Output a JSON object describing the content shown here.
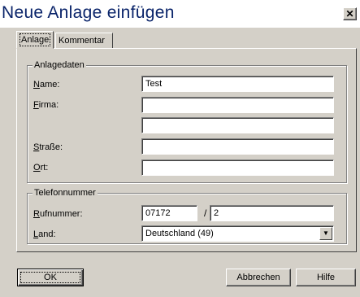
{
  "window": {
    "title": "Neue Anlage einfügen",
    "close_glyph": "✕"
  },
  "tabs": [
    {
      "label": "Anlage",
      "active": true
    },
    {
      "label": "Kommentar",
      "active": false
    }
  ],
  "anlagedaten": {
    "legend": "Anlagedaten",
    "name": {
      "label_ul": "N",
      "label_rest": "ame:",
      "value": "Test"
    },
    "firma": {
      "label_ul": "F",
      "label_rest": "irma:",
      "value": "",
      "value2": ""
    },
    "strasse": {
      "label_pre": "",
      "label_ul": "S",
      "label_rest": "traße:",
      "value": ""
    },
    "ort": {
      "label_ul": "O",
      "label_rest": "rt:",
      "value": ""
    }
  },
  "telefon": {
    "legend": "Telefonnummer",
    "rufnummer": {
      "label_ul": "R",
      "label_rest": "ufnummer:",
      "prefix": "07172",
      "separator": "/",
      "number": "2"
    },
    "land": {
      "label_ul": "L",
      "label_rest": "and:",
      "selected": "Deutschland (49)"
    }
  },
  "buttons": {
    "ok": "OK",
    "cancel": "Abbrechen",
    "help": "Hilfe"
  },
  "icons": {
    "dropdown": "dropdown-arrow-icon"
  }
}
